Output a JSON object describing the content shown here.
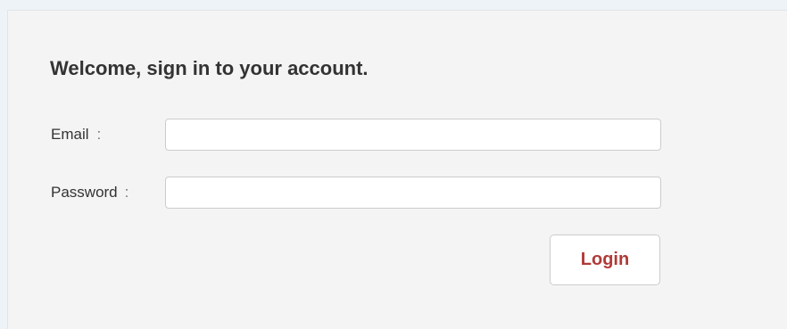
{
  "login_form": {
    "heading": "Welcome, sign in to your account.",
    "email": {
      "label": "Email",
      "separator": ":",
      "value": "",
      "placeholder": ""
    },
    "password": {
      "label": "Password",
      "separator": ":",
      "value": "",
      "placeholder": ""
    },
    "submit_label": "Login",
    "colors": {
      "panel_background": "#f4f4f4",
      "page_background": "#eef3f8",
      "button_text": "#b03a37",
      "heading_text": "#333333"
    }
  }
}
